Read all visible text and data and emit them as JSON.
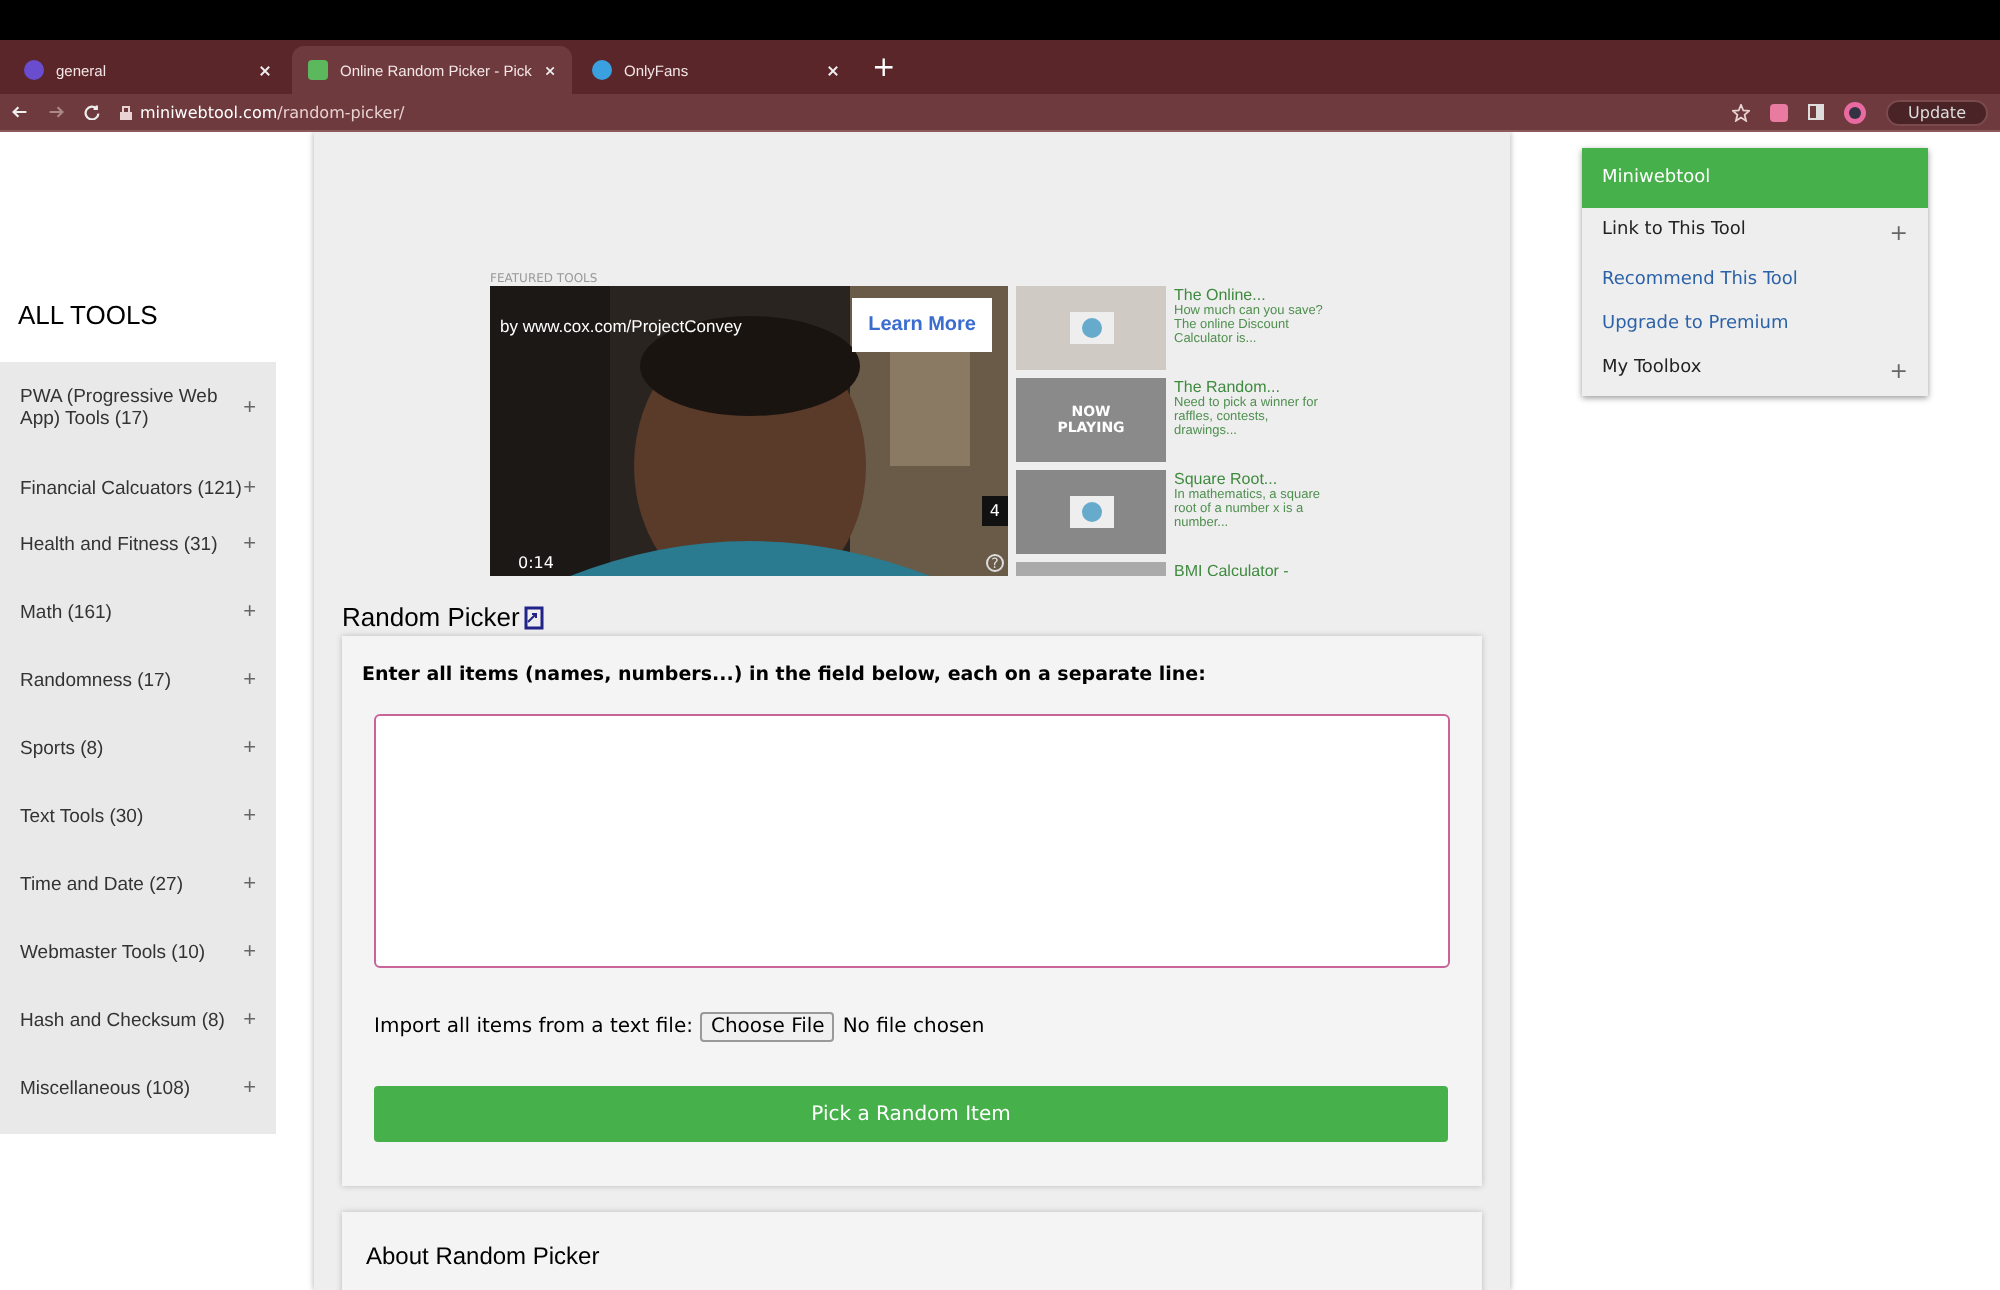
{
  "browser": {
    "tabs": [
      {
        "title": "general",
        "selected": false
      },
      {
        "title": "Online Random Picker - Pick",
        "selected": true
      },
      {
        "title": "OnlyFans",
        "selected": false
      }
    ],
    "new_tab": "+",
    "address": {
      "domain": "miniwebtool.com",
      "path": "/random-picker/"
    },
    "update_button": "Update"
  },
  "sidebar": {
    "title": "ALL TOOLS",
    "items": [
      {
        "label": "PWA (Progressive Web App) Tools (17)",
        "expand": "+"
      },
      {
        "label": "Financial Calcuators (121)",
        "expand": "+"
      },
      {
        "label": "Health and Fitness (31)",
        "expand": "+"
      },
      {
        "label": "Math (161)",
        "expand": "+"
      },
      {
        "label": "Randomness (17)",
        "expand": "+"
      },
      {
        "label": "Sports (8)",
        "expand": "+"
      },
      {
        "label": "Text Tools (30)",
        "expand": "+"
      },
      {
        "label": "Time and Date (27)",
        "expand": "+"
      },
      {
        "label": "Webmaster Tools (10)",
        "expand": "+"
      },
      {
        "label": "Hash and Checksum (8)",
        "expand": "+"
      },
      {
        "label": "Miscellaneous (108)",
        "expand": "+"
      }
    ]
  },
  "featured": {
    "label": "FEATURED TOOLS",
    "video": {
      "kind": "picture",
      "credit": "by www.cox.com/ProjectConvey",
      "cta": "Learn More",
      "count": "4",
      "time": "0:14",
      "help": "?"
    },
    "items": [
      {
        "title": "The Online...",
        "text": "How much can you save? The online Discount Calculator is..."
      },
      {
        "title": "The Random...",
        "text": "Need to pick a winner for raffles, contests, drawings...",
        "overlay": "NOW PLAYING"
      },
      {
        "title": "Square Root...",
        "text": "In mathematics, a square root of a number x is a number..."
      },
      {
        "title": "BMI Calculator -"
      }
    ]
  },
  "tool": {
    "title": "Random Picker",
    "instruction": "Enter all items (names, numbers...) in the field below, each on a separate line:",
    "import_label": "Import all items from a text file:",
    "file_button": "Choose File",
    "file_status": "No file chosen",
    "submit": "Pick a Random Item"
  },
  "about": {
    "title": "About Random Picker"
  },
  "menu": {
    "title": "Miniwebtool",
    "items": [
      {
        "label": "Link to This Tool",
        "kind": "expand",
        "expand": "+"
      },
      {
        "label": "Recommend This Tool",
        "kind": "link"
      },
      {
        "label": "Upgrade to Premium",
        "kind": "link"
      },
      {
        "label": "My Toolbox",
        "kind": "expand",
        "expand": "+"
      }
    ]
  }
}
